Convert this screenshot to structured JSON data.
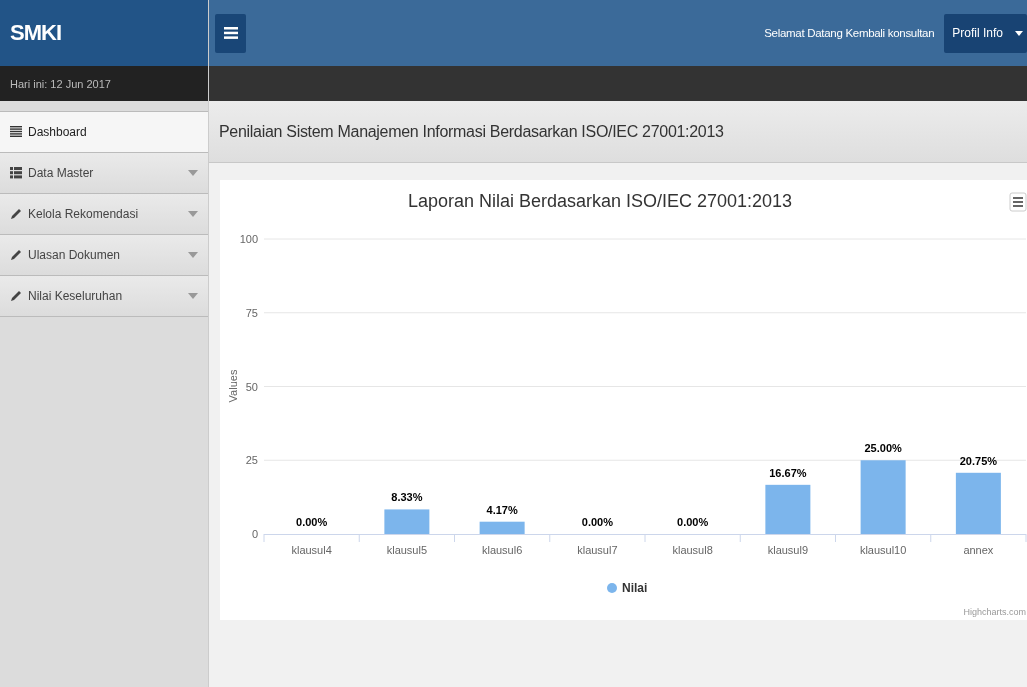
{
  "brand": "SMKI",
  "date": "Hari ini: 12 Jun 2017",
  "welcome": "Selamat Datang Kembali konsultan",
  "profile_button": "Profil Info",
  "sidebar": {
    "items": [
      {
        "label": "Dashboard",
        "selected": true,
        "has_submenu": false
      },
      {
        "label": "Data Master",
        "selected": false,
        "has_submenu": true
      },
      {
        "label": "Kelola Rekomendasi",
        "selected": false,
        "has_submenu": true
      },
      {
        "label": "Ulasan Dokumen",
        "selected": false,
        "has_submenu": true
      },
      {
        "label": "Nilai Keseluruhan",
        "selected": false,
        "has_submenu": true
      }
    ]
  },
  "page_title": "Penilaian Sistem Manajemen Informasi Berdasarkan ISO/IEC 27001:2013",
  "chart": {
    "chart_data": {
      "type": "bar",
      "title": "Laporan Nilai Berdasarkan ISO/IEC 27001:2013",
      "ylabel": "Values",
      "categories": [
        "klausul4",
        "klausul5",
        "klausul6",
        "klausul7",
        "klausul8",
        "klausul9",
        "klausul10",
        "annex"
      ],
      "series": [
        {
          "name": "Nilai",
          "color": "#7cb5ec",
          "values": [
            0,
            8.33,
            4.17,
            0,
            0,
            16.67,
            25,
            20.75
          ]
        }
      ],
      "ylim": [
        0,
        100
      ],
      "grid": true,
      "yticks": [
        0,
        25,
        50,
        75,
        100
      ],
      "value_labels": [
        "0.00%",
        "8.33%",
        "4.17%",
        "0.00%",
        "0.00%",
        "16.67%",
        "25.00%",
        "20.75%"
      ]
    },
    "credits": "Highcharts.com"
  }
}
